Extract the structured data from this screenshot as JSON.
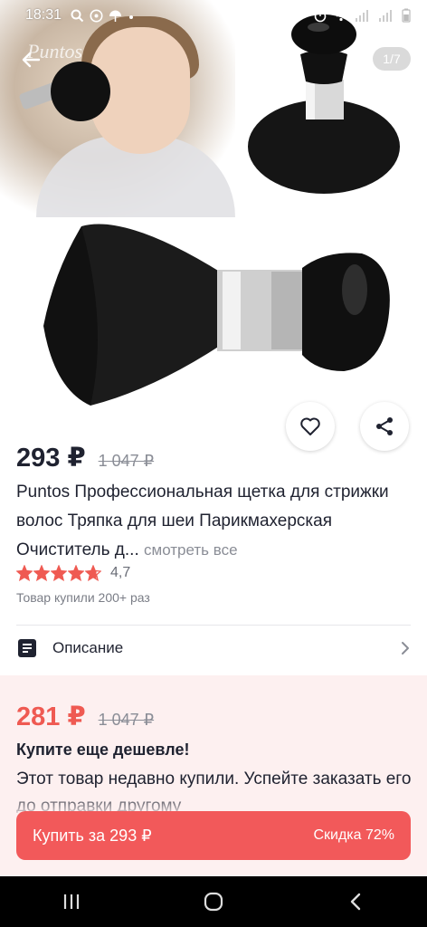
{
  "status_bar": {
    "time": "18:31"
  },
  "gallery": {
    "brand_watermark": "Puntos",
    "counter": "1/7"
  },
  "product": {
    "price": "293 ₽",
    "old_price": "1 047 ₽",
    "title": "Puntos Профессиональная щетка для стрижки волос Тряпка для шеи Парикмахерская Очиститель д...",
    "see_all": "смотреть все",
    "rating": "4,7",
    "rating_value": 4.7,
    "bought": "Товар купили 200+ раз"
  },
  "description": {
    "label": "Описание"
  },
  "promo": {
    "price": "281 ₽",
    "old_price": "1 047 ₽",
    "headline": "Купите еще дешевле!",
    "text": "Этот товар недавно купили. Успейте заказать его до отправки другому"
  },
  "buy_bar": {
    "label": "Купить за 293 ₽",
    "discount": "Скидка 72%"
  },
  "colors": {
    "accent": "#f2595a",
    "promo_price": "#ef5a52",
    "star": "#ef5a52",
    "promo_bg": "#fdf0f0"
  },
  "icons": [
    "back-arrow-icon",
    "heart-icon",
    "share-icon",
    "document-icon",
    "chevron-right-icon",
    "recents-icon",
    "home-icon",
    "nav-back-icon"
  ]
}
